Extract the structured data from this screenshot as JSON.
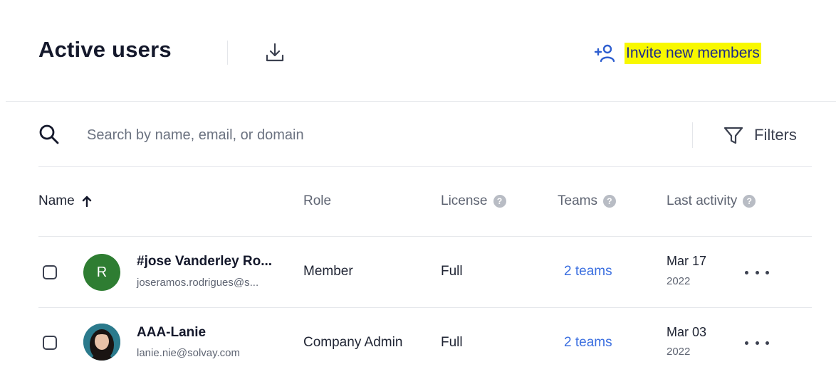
{
  "header": {
    "title": "Active users",
    "invite_label": "Invite new members"
  },
  "search": {
    "placeholder": "Search by name, email, or domain",
    "filters_label": "Filters"
  },
  "columns": {
    "name": "Name",
    "role": "Role",
    "license": "License",
    "teams": "Teams",
    "last_activity": "Last activity"
  },
  "rows": [
    {
      "initial": "R",
      "avatar_color": "#2e7d32",
      "name": "#jose Vanderley Ro...",
      "email": "joseramos.rodrigues@s...",
      "role": "Member",
      "license": "Full",
      "teams": "2 teams",
      "date": "Mar 17",
      "year": "2022"
    },
    {
      "initial": "",
      "avatar_color": "#2b7a8c",
      "name": "AAA-Lanie",
      "email": "lanie.nie@solvay.com",
      "role": "Company Admin",
      "license": "Full",
      "teams": "2 teams",
      "date": "Mar 03",
      "year": "2022"
    }
  ],
  "colors": {
    "accent": "#1c2a8a",
    "link": "#3b6fe0",
    "highlight": "#f8f800"
  },
  "icons": {
    "download": "download-icon",
    "invite": "add-user-icon",
    "search": "search-icon",
    "filter": "filter-icon",
    "sort": "arrow-up-icon",
    "help": "help-icon",
    "more": "more-icon"
  }
}
